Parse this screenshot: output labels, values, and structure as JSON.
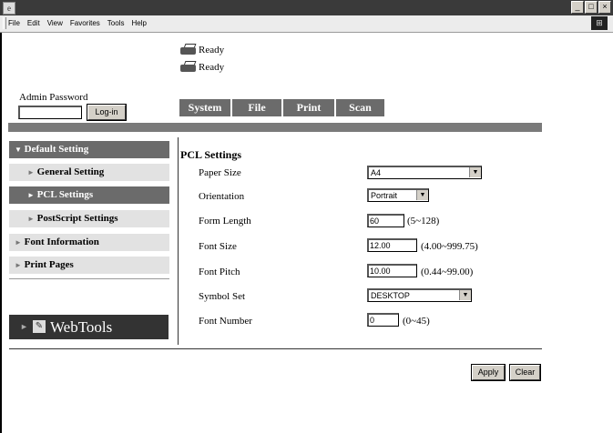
{
  "window": {
    "controls": [
      "_",
      "□",
      "×"
    ]
  },
  "menubar": {
    "items": [
      "File",
      "Edit",
      "View",
      "Favorites",
      "Tools",
      "Help"
    ]
  },
  "status": {
    "lines": [
      "Ready",
      "Ready"
    ],
    "icon": "printer-icon"
  },
  "admin": {
    "label": "Admin Password",
    "password_value": "",
    "login_label": "Log-in"
  },
  "tabs": [
    "System",
    "File",
    "Print",
    "Scan"
  ],
  "sidebar": {
    "items": [
      {
        "label": "Default Setting",
        "marker": "▼"
      },
      {
        "label": "General Setting",
        "marker": "►"
      },
      {
        "label": "PCL Settings",
        "marker": "►"
      },
      {
        "label": "PostScript Settings",
        "marker": "►"
      },
      {
        "label": "Font Information",
        "marker": "►"
      },
      {
        "label": "Print Pages",
        "marker": "►"
      }
    ],
    "webtools_label": "WebTools"
  },
  "form": {
    "title": "PCL Settings",
    "paper_size": {
      "label": "Paper Size",
      "value": "A4"
    },
    "orientation": {
      "label": "Orientation",
      "value": "Portrait"
    },
    "form_length": {
      "label": "Form Length",
      "value": "60",
      "range": "(5~128)"
    },
    "font_size": {
      "label": "Font Size",
      "value": "12.00",
      "range": "(4.00~999.75)"
    },
    "font_pitch": {
      "label": "Font Pitch",
      "value": "10.00",
      "range": "(0.44~99.00)"
    },
    "symbol_set": {
      "label": "Symbol Set",
      "value": "DESKTOP"
    },
    "font_number": {
      "label": "Font Number",
      "value": "0",
      "range": "(0~45)"
    }
  },
  "actions": {
    "apply_label": "Apply",
    "clear_label": "Clear"
  }
}
